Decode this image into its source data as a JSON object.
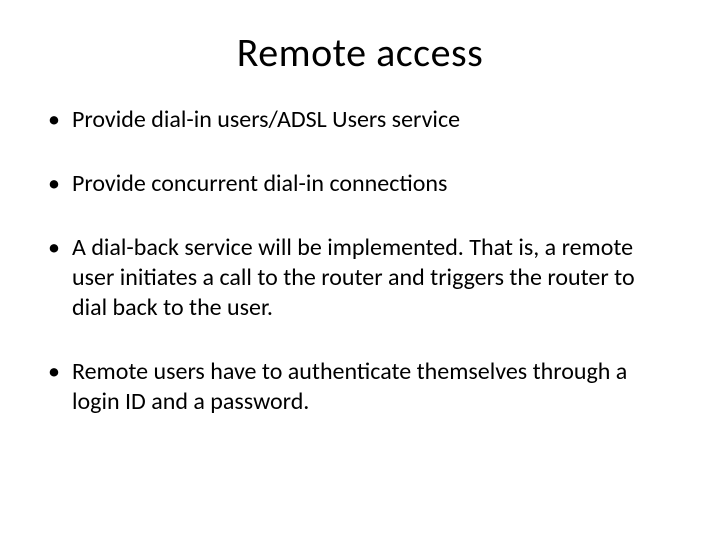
{
  "slide": {
    "title": "Remote access",
    "bullets": [
      "Provide dial-in users/ADSL Users service",
      "Provide concurrent dial-in connections",
      "A dial-back service will be implemented. That is, a remote user initiates a call to the router and triggers the router to dial back to the user.",
      "Remote users have to authenticate themselves through a login ID and a password."
    ]
  }
}
